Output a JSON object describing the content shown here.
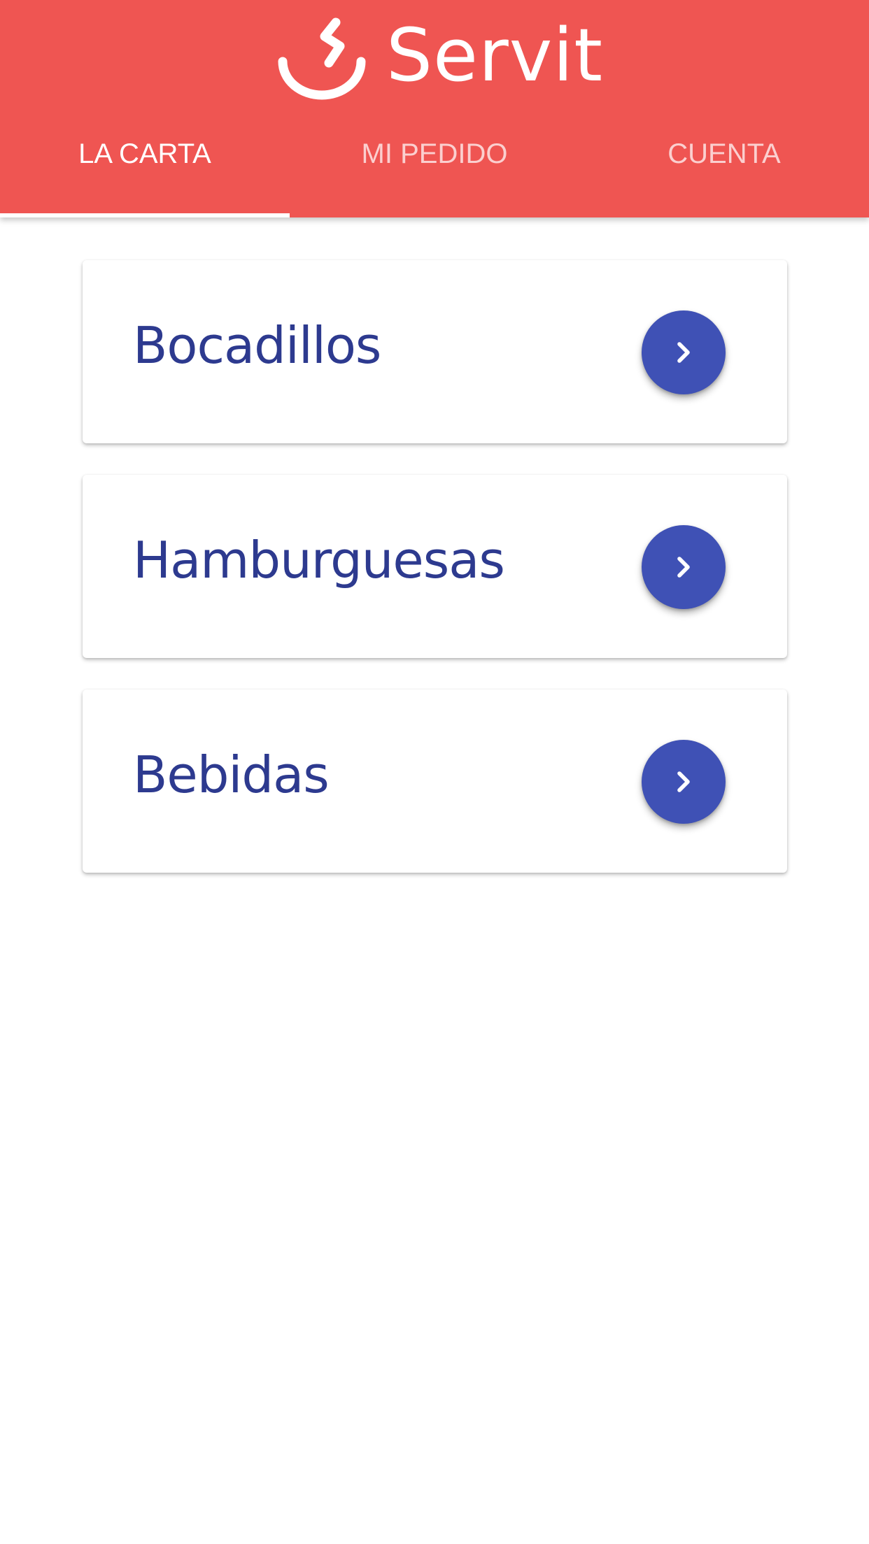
{
  "header": {
    "brand_name": "Servit",
    "logo_icon": "servit-logo-icon",
    "background_color": "#ef5552"
  },
  "tabs": [
    {
      "label": "LA CARTA",
      "active": true
    },
    {
      "label": "MI PEDIDO",
      "active": false
    },
    {
      "label": "CUENTA",
      "active": false
    }
  ],
  "categories": [
    {
      "label": "Bocadillos",
      "action_icon": "chevron-right-icon"
    },
    {
      "label": "Hamburguesas",
      "action_icon": "chevron-right-icon"
    },
    {
      "label": "Bebidas",
      "action_icon": "chevron-right-icon"
    }
  ],
  "colors": {
    "accent": "#3f51b5",
    "category_text": "#2d3a8f"
  }
}
